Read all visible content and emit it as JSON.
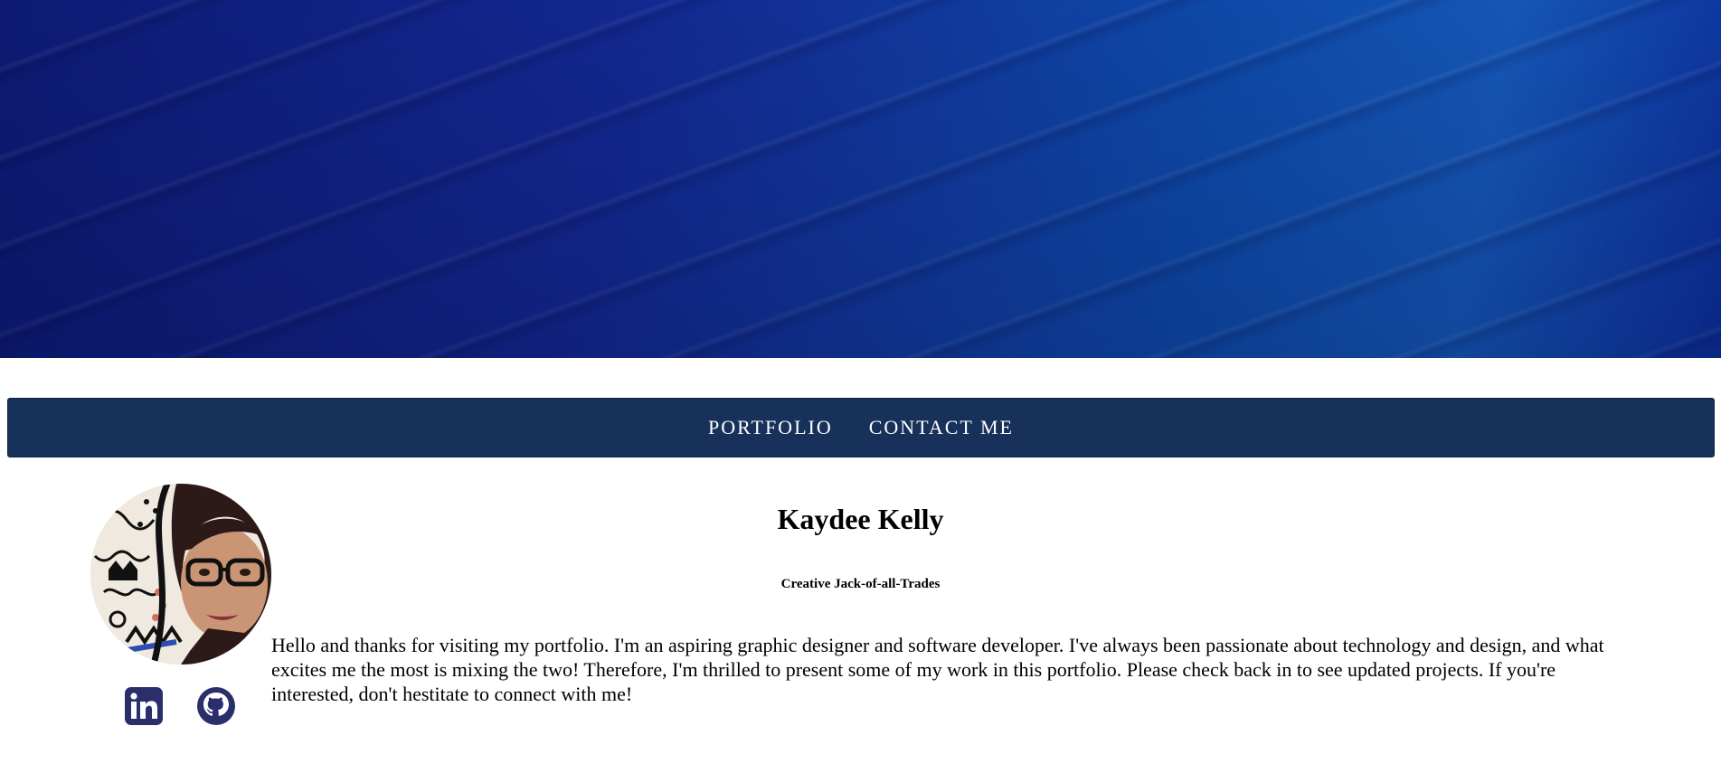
{
  "nav": {
    "portfolio_label": "PORTFOLIO",
    "contact_label": "CONTACT ME"
  },
  "profile": {
    "name": "Kaydee Kelly",
    "tagline": "Creative Jack-of-all-Trades",
    "bio": "Hello and thanks for visiting my portfolio. I'm an aspiring graphic designer and software developer. I've always been passionate about technology and design, and what excites me the most is mixing the two! Therefore, I'm thrilled to present some of my work in this portfolio. Please check back in to see updated projects. If you're interested, don't hestitate to connect with me!"
  },
  "social": [
    {
      "icon": "linkedin-icon",
      "color": "#2a2f6b"
    },
    {
      "icon": "github-icon",
      "color": "#2a2f6b"
    }
  ],
  "colors": {
    "navbar": "#17315b",
    "hero_dark": "#0c1a73",
    "hero_light": "#1556b6"
  }
}
